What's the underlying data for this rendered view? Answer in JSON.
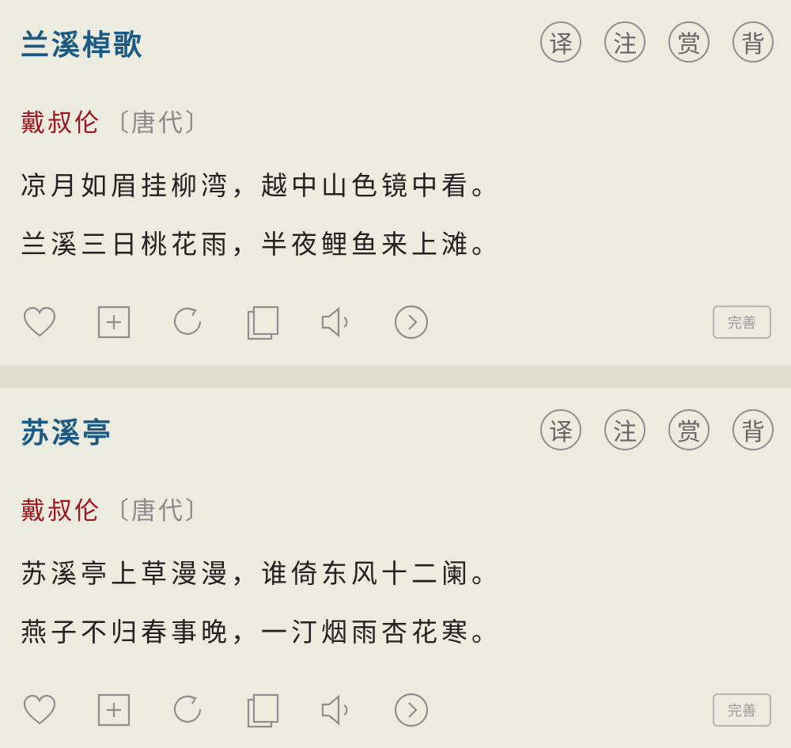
{
  "poems": [
    {
      "title": "兰溪棹歌",
      "author": "戴叔伦",
      "dynasty": "〔唐代〕",
      "lines": [
        "凉月如眉挂柳湾，越中山色镜中看。",
        "兰溪三日桃花雨，半夜鲤鱼来上滩。"
      ],
      "buttons": [
        "译",
        "注",
        "赏",
        "背"
      ],
      "fix_label": "完善"
    },
    {
      "title": "苏溪亭",
      "author": "戴叔伦",
      "dynasty": "〔唐代〕",
      "lines": [
        "苏溪亭上草漫漫，谁倚东风十二阑。",
        "燕子不归春事晚，一汀烟雨杏花寒。"
      ],
      "buttons": [
        "译",
        "注",
        "赏",
        "背"
      ],
      "fix_label": "完善"
    }
  ],
  "action_icons": [
    "heart-icon",
    "add-icon",
    "refresh-icon",
    "copy-icon",
    "speaker-icon",
    "next-icon"
  ],
  "colors": {
    "title": "#1c5a86",
    "author": "#a0161e",
    "background": "#ecebdf"
  }
}
